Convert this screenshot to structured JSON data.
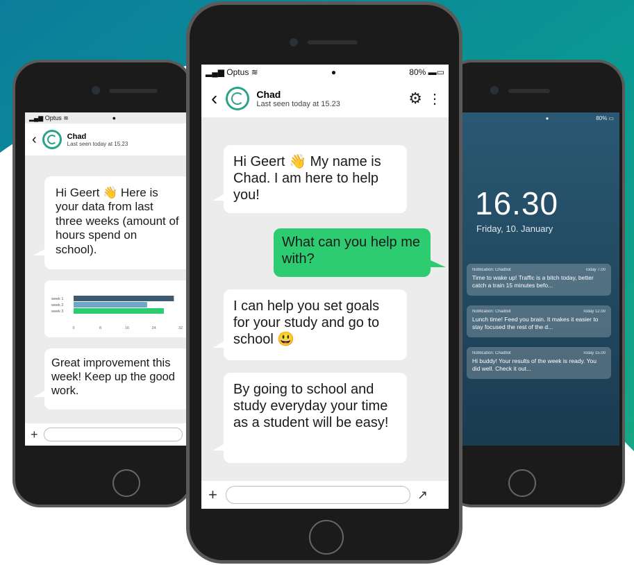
{
  "colors": {
    "teal": "#0a8f94",
    "green": "#2ecc71",
    "lock_bg": "#1f4d63"
  },
  "left_phone": {
    "carrier": "Optus",
    "contact_name": "Chad",
    "last_seen": "Last seen today at 15.23",
    "messages": [
      {
        "text": "Hi Geert 👋 Here is your data from last three weeks (amount of hours spend on school).",
        "from": "bot"
      },
      {
        "text": "Great improvement this week! Keep up the good work.",
        "from": "bot"
      }
    ],
    "chart_data": {
      "type": "bar",
      "orientation": "horizontal",
      "categories": [
        "week 1",
        "week 2",
        "week 3"
      ],
      "values": [
        30,
        22,
        27
      ],
      "xlim": [
        0,
        32
      ],
      "xticks": [
        "0",
        "8",
        "16",
        "24",
        "32"
      ],
      "colors": [
        "#3d5a73",
        "#6aa7c8",
        "#2ecc71"
      ]
    },
    "plus_icon": "plus-icon"
  },
  "center_phone": {
    "carrier": "Optus",
    "battery": "80%",
    "contact_name": "Chad",
    "last_seen": "Last seen today at 15.23",
    "messages": [
      {
        "text": "Hi Geert 👋 My name is Chad. I am here to help you!",
        "from": "bot"
      },
      {
        "text": "What can you help me with?",
        "from": "user"
      },
      {
        "text": "I can help you set goals for your study and go to school 😃",
        "from": "bot"
      },
      {
        "text": "By going to school and study everyday your time as a student will be easy!",
        "from": "bot"
      }
    ]
  },
  "right_phone": {
    "battery": "80%",
    "time": "16.30",
    "date": "Friday, 10. January",
    "notifications": [
      {
        "title": "Notification: Chadbot",
        "time": "Today 7.00",
        "body": "Time to wake up! Traffic is a bitch today, better catch a train 15 minutes befo..."
      },
      {
        "title": "Notification: Chadbot",
        "time": "Today 12.00",
        "body": "Lunch time! Feed you brain. It makes it easier to stay focused the rest of the d..."
      },
      {
        "title": "Notification: Chadbot",
        "time": "Today 15.00",
        "body": "Hi buddy! Your results of the week is ready. You did well. Check it out..."
      }
    ]
  }
}
